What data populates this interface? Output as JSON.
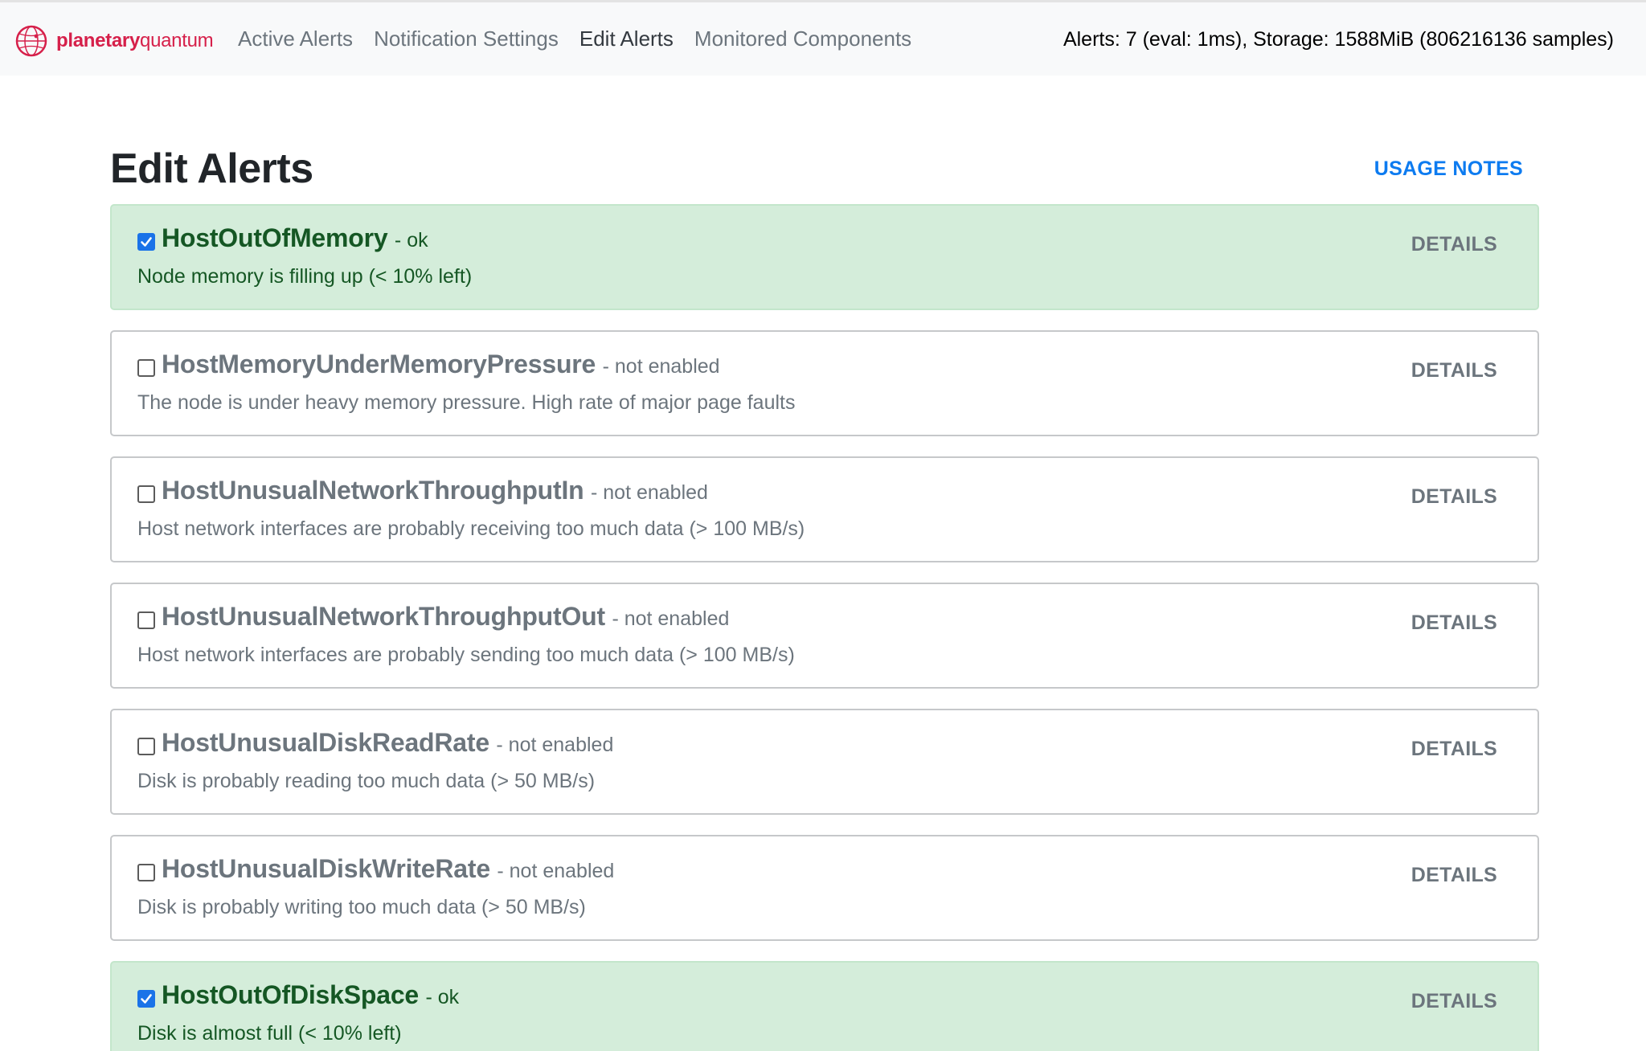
{
  "brand": {
    "bold": "planetary",
    "light": "quantum"
  },
  "nav": {
    "links": [
      {
        "label": "Active Alerts",
        "active": false
      },
      {
        "label": "Notification Settings",
        "active": false
      },
      {
        "label": "Edit Alerts",
        "active": true
      },
      {
        "label": "Monitored Components",
        "active": false
      }
    ],
    "status": "Alerts: 7 (eval: 1ms), Storage: 1588MiB (806216136 samples)"
  },
  "page": {
    "title": "Edit Alerts",
    "usage_notes": "USAGE NOTES",
    "details_label": "DETAILS"
  },
  "colors": {
    "brand": "#d6204a",
    "link": "#0d7bf0",
    "enabled_bg": "#d4edda",
    "enabled_text": "#155724"
  },
  "alerts": [
    {
      "name": "HostOutOfMemory",
      "state": "- ok",
      "enabled": true,
      "description": "Node memory is filling up (< 10% left)"
    },
    {
      "name": "HostMemoryUnderMemoryPressure",
      "state": "- not enabled",
      "enabled": false,
      "description": "The node is under heavy memory pressure. High rate of major page faults"
    },
    {
      "name": "HostUnusualNetworkThroughputIn",
      "state": "- not enabled",
      "enabled": false,
      "description": "Host network interfaces are probably receiving too much data (> 100 MB/s)"
    },
    {
      "name": "HostUnusualNetworkThroughputOut",
      "state": "- not enabled",
      "enabled": false,
      "description": "Host network interfaces are probably sending too much data (> 100 MB/s)"
    },
    {
      "name": "HostUnusualDiskReadRate",
      "state": "- not enabled",
      "enabled": false,
      "description": "Disk is probably reading too much data (> 50 MB/s)"
    },
    {
      "name": "HostUnusualDiskWriteRate",
      "state": "- not enabled",
      "enabled": false,
      "description": "Disk is probably writing too much data (> 50 MB/s)"
    },
    {
      "name": "HostOutOfDiskSpace",
      "state": "- ok",
      "enabled": true,
      "description": "Disk is almost full (< 10% left)"
    }
  ]
}
